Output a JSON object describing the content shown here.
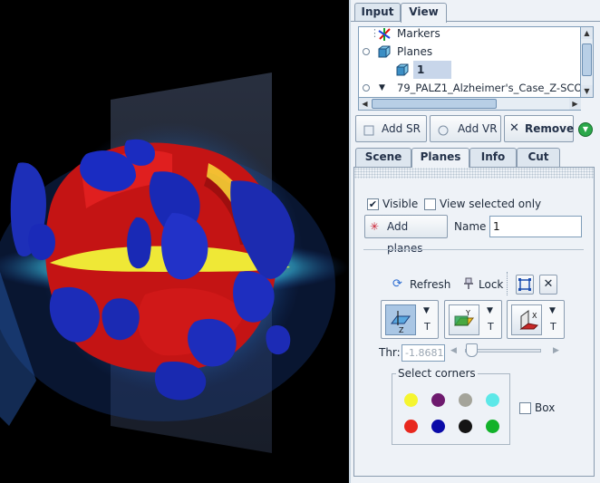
{
  "main_tabs": [
    {
      "label": "Input"
    },
    {
      "label": "View"
    }
  ],
  "tree": {
    "items": [
      {
        "label": "Markers",
        "icon": "markers-axes-icon"
      },
      {
        "label": "Planes",
        "icon": "planes-cube-icon"
      },
      {
        "label": "1",
        "icon": "plane-cube-icon",
        "selected": true
      },
      {
        "label": "79_PALZ1_Alzheimer's_Case_Z-SCO",
        "icon": "volume-node-icon"
      }
    ]
  },
  "actions": {
    "add_sr": "Add SR",
    "add_vr": "Add VR",
    "remove": "Remove"
  },
  "sub_tabs": [
    {
      "label": "Scene"
    },
    {
      "label": "Planes"
    },
    {
      "label": "Info"
    },
    {
      "label": "Cut"
    }
  ],
  "planes": {
    "visible_label": "Visible",
    "visible_checked": true,
    "view_selected_label": "View selected only",
    "view_selected_checked": false,
    "add_planes_label": "Add planes",
    "name_label": "Name",
    "name_value": "1",
    "refresh_label": "Refresh",
    "lock_label": "Lock",
    "plane_buttons": [
      {
        "axis": "Z",
        "t_label": "T",
        "pressed": true
      },
      {
        "axis": "Y",
        "t_label": "T",
        "pressed": false
      },
      {
        "axis": "X",
        "t_label": "T",
        "pressed": false
      }
    ],
    "threshold_label": "Thr:",
    "threshold_value": "-1.8681",
    "select_corners_label": "Select corners",
    "corner_colors": [
      "#f5f530",
      "#6e1a6e",
      "#a4a49a",
      "#5de8e8",
      "#e8281e",
      "#0a0aa8",
      "#141414",
      "#12b22a"
    ],
    "box_label": "Box",
    "box_checked": false
  },
  "colors": {
    "panel_bg": "#eef2f7",
    "viewport_bg": "#000000",
    "accent_green": "#2ba84a",
    "selection": "#c8d6ea"
  }
}
